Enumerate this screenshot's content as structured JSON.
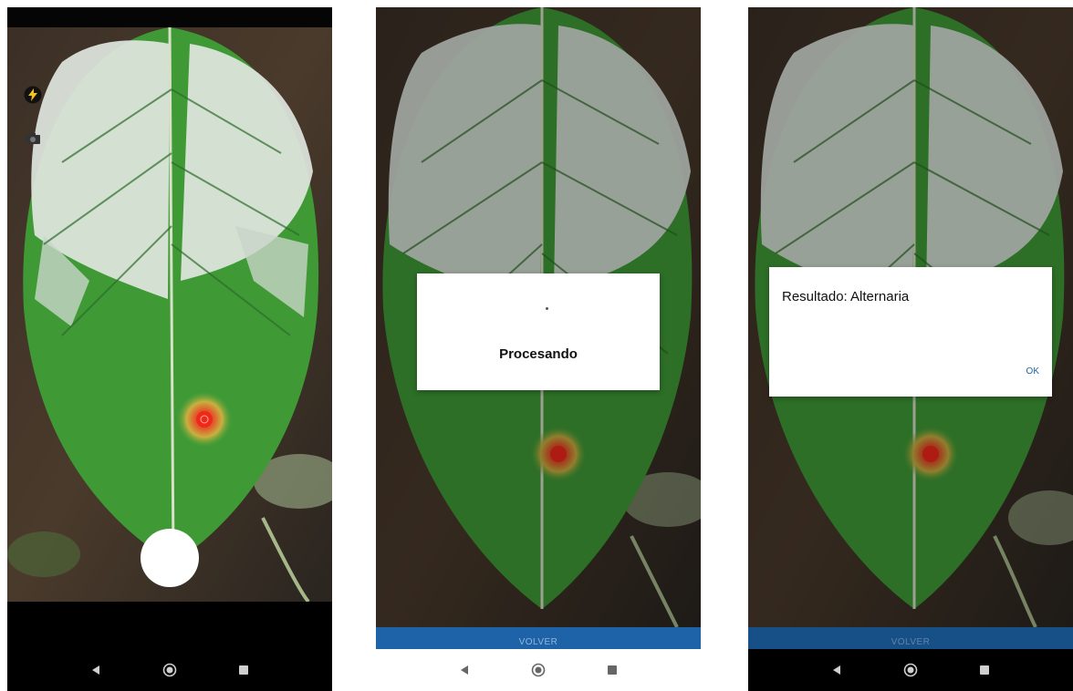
{
  "screens": {
    "camera": {
      "flash_icon": "lightning-bolt-icon",
      "mode_icon": "camera-switch-icon",
      "shutter_icon": "shutter-button"
    },
    "processing": {
      "dialog_text": "Procesando",
      "back_button": "VOLVER"
    },
    "result": {
      "dialog_text": "Resultado: Alternaria",
      "ok_button": "OK",
      "back_button": "VOLVER"
    }
  },
  "nav": {
    "back_icon": "triangle-back-icon",
    "home_icon": "circle-home-icon",
    "recents_icon": "square-recents-icon"
  },
  "colors": {
    "accent": "#1e63a8",
    "leaf_dark": "#2f7d2c",
    "leaf_light": "#d9e2dc",
    "spot": "#e03a2a"
  }
}
